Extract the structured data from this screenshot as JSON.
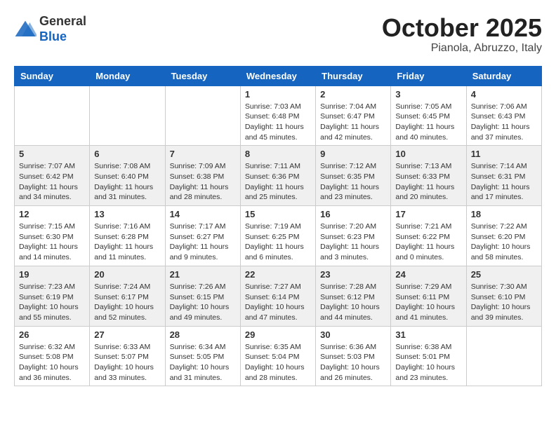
{
  "logo": {
    "general": "General",
    "blue": "Blue"
  },
  "header": {
    "month": "October 2025",
    "location": "Pianola, Abruzzo, Italy"
  },
  "days_of_week": [
    "Sunday",
    "Monday",
    "Tuesday",
    "Wednesday",
    "Thursday",
    "Friday",
    "Saturday"
  ],
  "weeks": [
    [
      {
        "day": "",
        "info": ""
      },
      {
        "day": "",
        "info": ""
      },
      {
        "day": "",
        "info": ""
      },
      {
        "day": "1",
        "info": "Sunrise: 7:03 AM\nSunset: 6:48 PM\nDaylight: 11 hours and 45 minutes."
      },
      {
        "day": "2",
        "info": "Sunrise: 7:04 AM\nSunset: 6:47 PM\nDaylight: 11 hours and 42 minutes."
      },
      {
        "day": "3",
        "info": "Sunrise: 7:05 AM\nSunset: 6:45 PM\nDaylight: 11 hours and 40 minutes."
      },
      {
        "day": "4",
        "info": "Sunrise: 7:06 AM\nSunset: 6:43 PM\nDaylight: 11 hours and 37 minutes."
      }
    ],
    [
      {
        "day": "5",
        "info": "Sunrise: 7:07 AM\nSunset: 6:42 PM\nDaylight: 11 hours and 34 minutes."
      },
      {
        "day": "6",
        "info": "Sunrise: 7:08 AM\nSunset: 6:40 PM\nDaylight: 11 hours and 31 minutes."
      },
      {
        "day": "7",
        "info": "Sunrise: 7:09 AM\nSunset: 6:38 PM\nDaylight: 11 hours and 28 minutes."
      },
      {
        "day": "8",
        "info": "Sunrise: 7:11 AM\nSunset: 6:36 PM\nDaylight: 11 hours and 25 minutes."
      },
      {
        "day": "9",
        "info": "Sunrise: 7:12 AM\nSunset: 6:35 PM\nDaylight: 11 hours and 23 minutes."
      },
      {
        "day": "10",
        "info": "Sunrise: 7:13 AM\nSunset: 6:33 PM\nDaylight: 11 hours and 20 minutes."
      },
      {
        "day": "11",
        "info": "Sunrise: 7:14 AM\nSunset: 6:31 PM\nDaylight: 11 hours and 17 minutes."
      }
    ],
    [
      {
        "day": "12",
        "info": "Sunrise: 7:15 AM\nSunset: 6:30 PM\nDaylight: 11 hours and 14 minutes."
      },
      {
        "day": "13",
        "info": "Sunrise: 7:16 AM\nSunset: 6:28 PM\nDaylight: 11 hours and 11 minutes."
      },
      {
        "day": "14",
        "info": "Sunrise: 7:17 AM\nSunset: 6:27 PM\nDaylight: 11 hours and 9 minutes."
      },
      {
        "day": "15",
        "info": "Sunrise: 7:19 AM\nSunset: 6:25 PM\nDaylight: 11 hours and 6 minutes."
      },
      {
        "day": "16",
        "info": "Sunrise: 7:20 AM\nSunset: 6:23 PM\nDaylight: 11 hours and 3 minutes."
      },
      {
        "day": "17",
        "info": "Sunrise: 7:21 AM\nSunset: 6:22 PM\nDaylight: 11 hours and 0 minutes."
      },
      {
        "day": "18",
        "info": "Sunrise: 7:22 AM\nSunset: 6:20 PM\nDaylight: 10 hours and 58 minutes."
      }
    ],
    [
      {
        "day": "19",
        "info": "Sunrise: 7:23 AM\nSunset: 6:19 PM\nDaylight: 10 hours and 55 minutes."
      },
      {
        "day": "20",
        "info": "Sunrise: 7:24 AM\nSunset: 6:17 PM\nDaylight: 10 hours and 52 minutes."
      },
      {
        "day": "21",
        "info": "Sunrise: 7:26 AM\nSunset: 6:15 PM\nDaylight: 10 hours and 49 minutes."
      },
      {
        "day": "22",
        "info": "Sunrise: 7:27 AM\nSunset: 6:14 PM\nDaylight: 10 hours and 47 minutes."
      },
      {
        "day": "23",
        "info": "Sunrise: 7:28 AM\nSunset: 6:12 PM\nDaylight: 10 hours and 44 minutes."
      },
      {
        "day": "24",
        "info": "Sunrise: 7:29 AM\nSunset: 6:11 PM\nDaylight: 10 hours and 41 minutes."
      },
      {
        "day": "25",
        "info": "Sunrise: 7:30 AM\nSunset: 6:10 PM\nDaylight: 10 hours and 39 minutes."
      }
    ],
    [
      {
        "day": "26",
        "info": "Sunrise: 6:32 AM\nSunset: 5:08 PM\nDaylight: 10 hours and 36 minutes."
      },
      {
        "day": "27",
        "info": "Sunrise: 6:33 AM\nSunset: 5:07 PM\nDaylight: 10 hours and 33 minutes."
      },
      {
        "day": "28",
        "info": "Sunrise: 6:34 AM\nSunset: 5:05 PM\nDaylight: 10 hours and 31 minutes."
      },
      {
        "day": "29",
        "info": "Sunrise: 6:35 AM\nSunset: 5:04 PM\nDaylight: 10 hours and 28 minutes."
      },
      {
        "day": "30",
        "info": "Sunrise: 6:36 AM\nSunset: 5:03 PM\nDaylight: 10 hours and 26 minutes."
      },
      {
        "day": "31",
        "info": "Sunrise: 6:38 AM\nSunset: 5:01 PM\nDaylight: 10 hours and 23 minutes."
      },
      {
        "day": "",
        "info": ""
      }
    ]
  ]
}
